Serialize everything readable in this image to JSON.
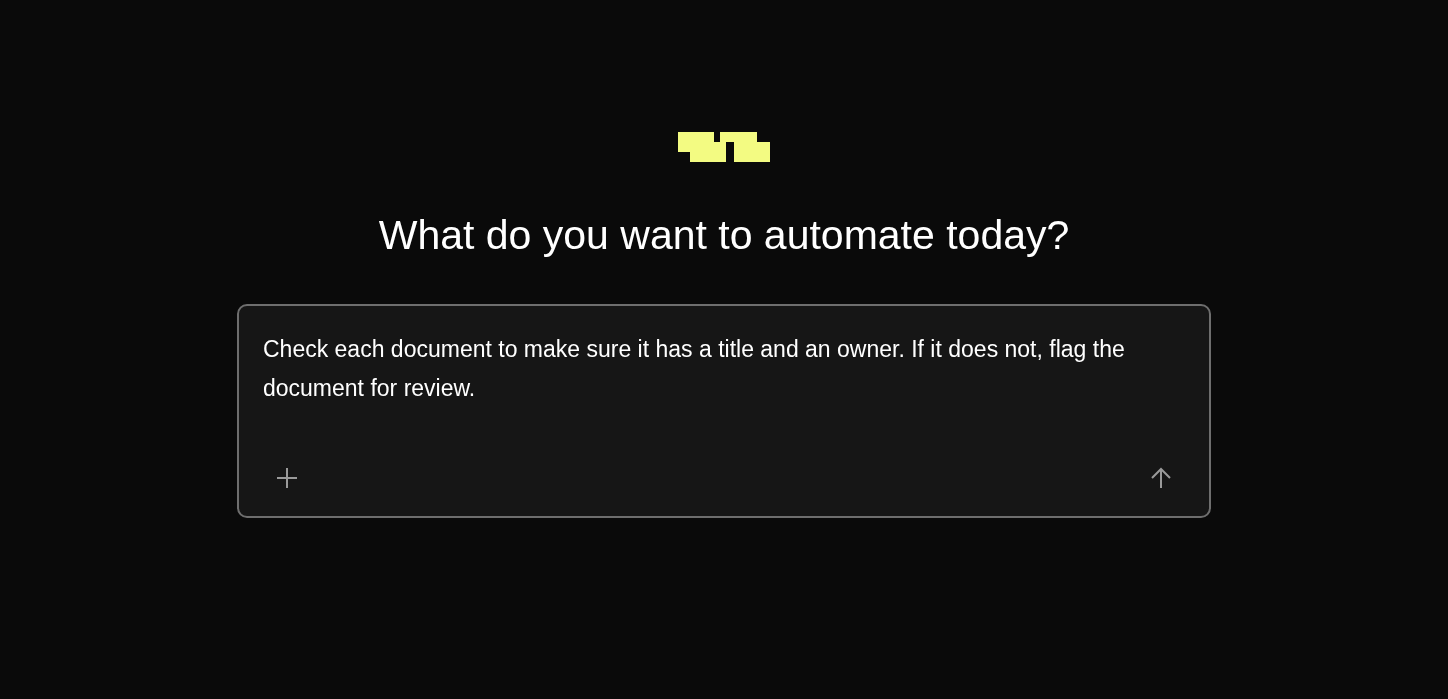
{
  "heading": "What do you want to automate today?",
  "prompt": {
    "value": "Check each document to make sure it has a title and an owner. If it does not, flag the document for review."
  }
}
